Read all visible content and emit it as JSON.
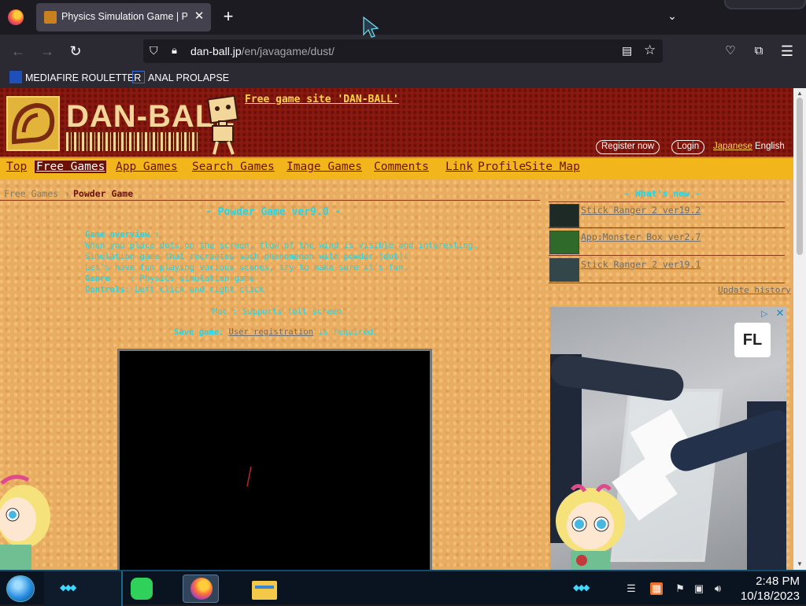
{
  "browser": {
    "tab_title": "Physics Simulation Game | Powder Game",
    "tab_close": "✕",
    "new_tab": "+",
    "tab_list": "⌄",
    "url_host": "dan-ball.jp",
    "url_path": "/en/javagame/dust/",
    "bookmarks": [
      {
        "label": "MEDIAFIRE ROULETTER"
      },
      {
        "label": "ANAL PROLAPSE"
      }
    ]
  },
  "site": {
    "logo_text": "DAN-BALL",
    "free_game_site": "Free game site 'DAN-BALL'",
    "register": "Register now",
    "login": "Login",
    "lang_japanese": "Japanese",
    "lang_english": "English",
    "nav": [
      "Top",
      "Free Games",
      "App Games",
      "Search Games",
      "Image Games",
      "Comments",
      "Link",
      "Profile",
      "Site Map"
    ],
    "active_nav": "Free Games",
    "breadcrumb": [
      "Free Games",
      "Powder Game"
    ]
  },
  "game": {
    "title": "- Powder Game ver9.0 -",
    "overview_label": "Game overview :",
    "overview_lines": [
      "When you place dots on the screen, flow of the wind is visible and interesting.",
      "Simulation game that recreates such phenomenon with powder (dot)!",
      "Let's have fun playing various scenes, try to make sure it's fun."
    ],
    "genre_label": "Genre",
    "genre_value": ": Physics simulation game",
    "controls_label": "Controls",
    "controls_value": ": Left click and right click",
    "note1": "Mac : Supports full screen.",
    "save_label": "Save game:",
    "save_link": "User registration",
    "save_suffix": "is required."
  },
  "sidebar": {
    "whats_new": "- What's new -",
    "news": [
      {
        "label": "Stick Ranger 2 ver19.2"
      },
      {
        "label": "App:Monster Box ver2.7"
      },
      {
        "label": "Stick Ranger 2 ver19.1"
      }
    ],
    "update_history": "Update history",
    "ad_logo": "FL"
  },
  "taskbar": {
    "time": "2:48 PM",
    "date": "10/18/2023"
  },
  "colors": {
    "page_bg": "#e9ad62",
    "header_bg": "#8a1a10",
    "nav_bg": "#f2b61c",
    "accent_cyan": "#21d6e6"
  }
}
